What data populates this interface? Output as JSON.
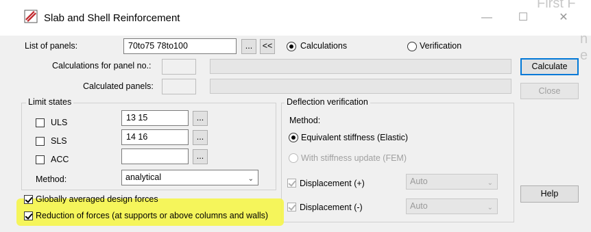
{
  "window": {
    "title": "Slab and Shell Reinforcement",
    "bg_peek_1": "First F",
    "bg_peek_2": "n",
    "bg_peek_3": "e"
  },
  "panels": {
    "list_label": "List of panels:",
    "list_value": "70to75 78to100",
    "browse_label": "...",
    "back_label": "<<",
    "mode_options": [
      "Calculations",
      "Verification"
    ],
    "mode_selected": "Calculations",
    "calc_panel_label": "Calculations for panel no.:",
    "calculated_label": "Calculated panels:"
  },
  "limit_states": {
    "title": "Limit states",
    "rows": [
      {
        "label": "ULS",
        "value": "13 15",
        "btn": "..."
      },
      {
        "label": "SLS",
        "value": "14 16",
        "btn": "..."
      },
      {
        "label": "ACC",
        "value": "",
        "btn": "..."
      }
    ],
    "method_label": "Method:",
    "method_value": "analytical"
  },
  "deflection": {
    "title": "Deflection verification",
    "method_label": "Method:",
    "option_elastic": "Equivalent stiffness (Elastic)",
    "option_fem": "With stiffness update (FEM)",
    "disp_plus": "Displacement (+)",
    "disp_minus": "Displacement (-)",
    "auto_plus": "Auto",
    "auto_minus": "Auto"
  },
  "options": {
    "globally_averaged": "Globally averaged design forces",
    "reduction": "Reduction of forces (at supports or above columns and walls)"
  },
  "buttons": {
    "calculate": "Calculate",
    "close": "Close",
    "help": "Help"
  },
  "colors": {
    "highlight": "#f5f54a",
    "default_button_border": "#0078d7"
  }
}
